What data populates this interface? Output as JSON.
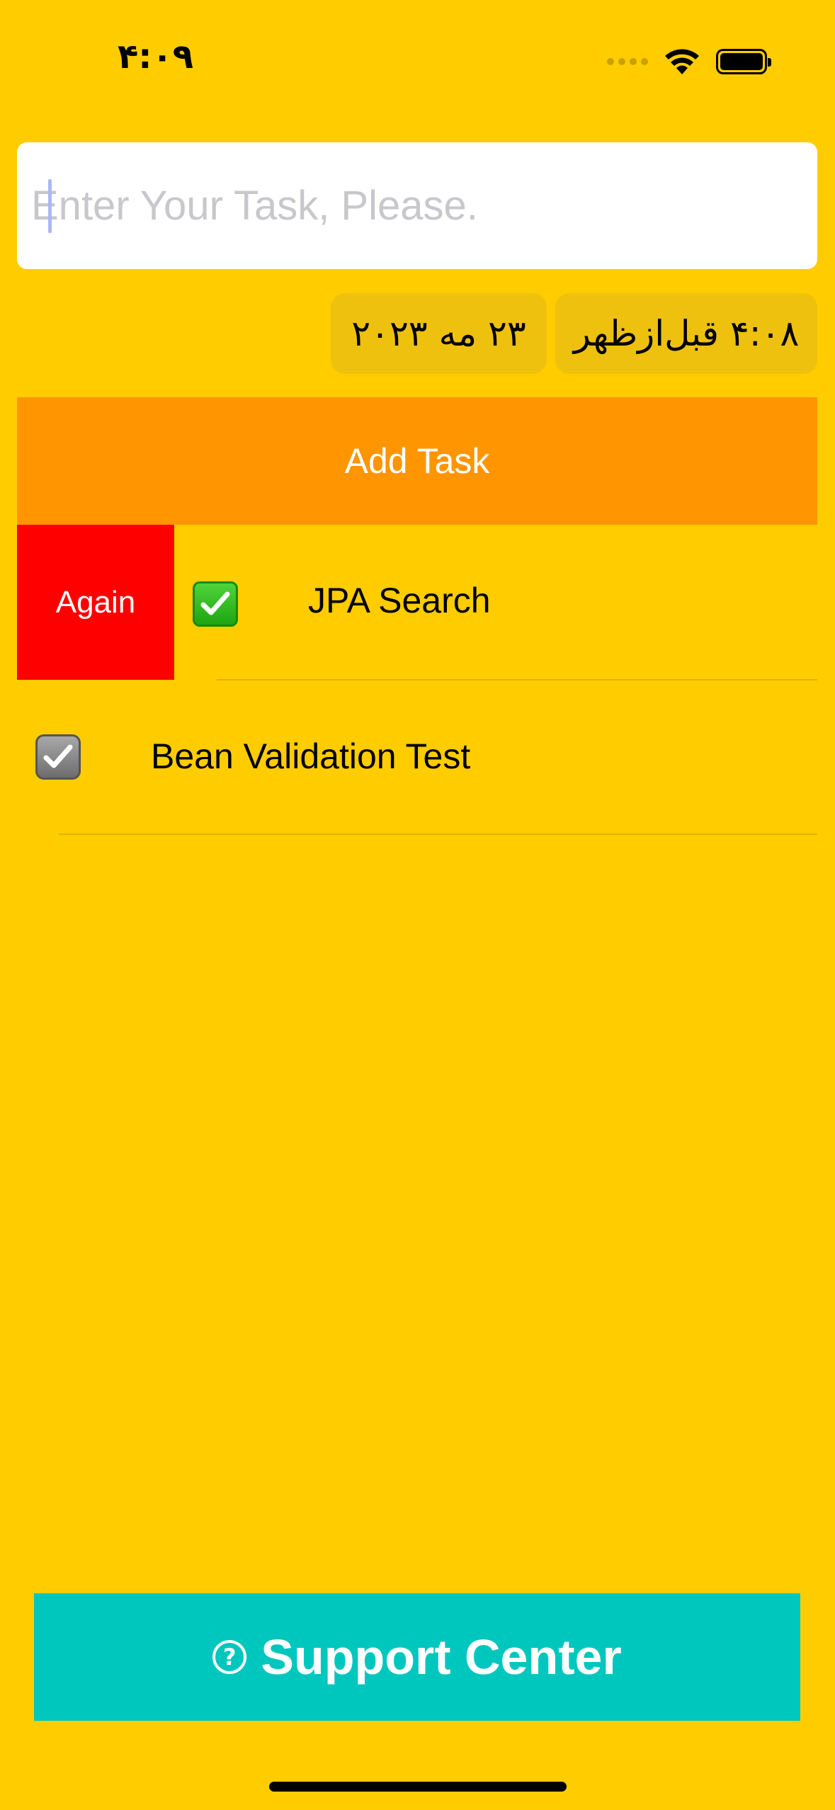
{
  "status_bar": {
    "time": "۴:۰۹",
    "icons": [
      "signal-dots-icon",
      "wifi-icon",
      "battery-icon"
    ]
  },
  "task_input": {
    "value": "",
    "placeholder": "Enter Your Task, Please."
  },
  "date_picker": {
    "date": "۲۳ مه ۲۰۲۳",
    "time": "۴:۰۸ قبل‌ازظهر"
  },
  "add_task": {
    "label": "Add Task"
  },
  "tasks": [
    {
      "label": "JPA Search",
      "swipe_action": "Again",
      "status_icon": "green-checkmark-icon"
    },
    {
      "label": "Bean Validation Test",
      "status_icon": "gray-checkmark-icon"
    }
  ],
  "support": {
    "label": "Support Center",
    "icon": "question-circle-icon"
  },
  "colors": {
    "background": "#FFCC00",
    "add_task": "#FF9500",
    "again": "#FF0000",
    "support": "#00C7BE",
    "pill": "#EEC10E"
  }
}
